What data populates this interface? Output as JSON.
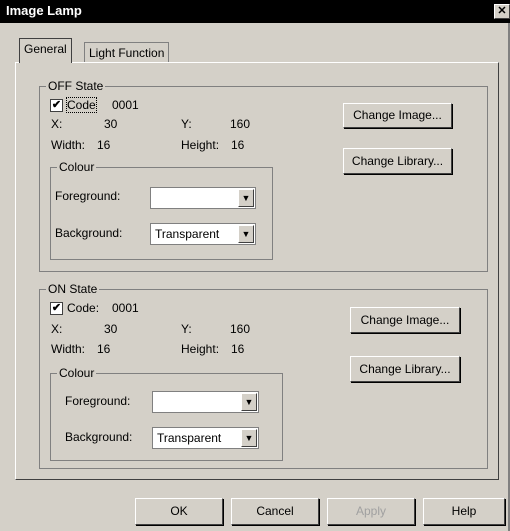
{
  "window": {
    "title": "Image Lamp",
    "close_glyph": "✕"
  },
  "tabs": [
    {
      "label": "General"
    },
    {
      "label": "Light Function"
    }
  ],
  "off_state": {
    "legend": "OFF State",
    "code_checked": true,
    "code_label": "Code",
    "code_value": "0001",
    "x_label": "X:",
    "x_value": "30",
    "y_label": "Y:",
    "y_value": "160",
    "width_label": "Width:",
    "width_value": "16",
    "height_label": "Height:",
    "height_value": "16",
    "change_image": "Change Image...",
    "change_library": "Change Library...",
    "colour": {
      "legend": "Colour",
      "foreground_label": "Foreground:",
      "foreground_value": "",
      "background_label": "Background:",
      "background_value": "Transparent"
    }
  },
  "on_state": {
    "legend": "ON State",
    "code_checked": true,
    "code_label": "Code:",
    "code_value": "0001",
    "x_label": "X:",
    "x_value": "30",
    "y_label": "Y:",
    "y_value": "160",
    "width_label": "Width:",
    "width_value": "16",
    "height_label": "Height:",
    "height_value": "16",
    "change_image": "Change Image...",
    "change_library": "Change Library...",
    "colour": {
      "legend": "Colour",
      "foreground_label": "Foreground:",
      "foreground_value": "",
      "background_label": "Background:",
      "background_value": "Transparent"
    }
  },
  "footer": {
    "ok": "OK",
    "cancel": "Cancel",
    "apply": "Apply",
    "help": "Help"
  },
  "icons": {
    "checkbox_check": "✔",
    "dropdown_arrow": "▼"
  }
}
